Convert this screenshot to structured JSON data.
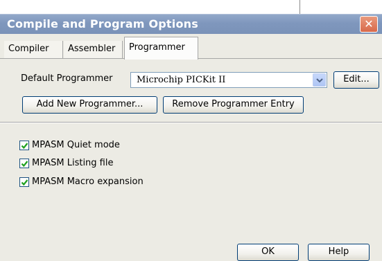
{
  "window": {
    "title": "Compile and Program Options",
    "close_label": "✕"
  },
  "tabs": [
    {
      "label": "Compiler",
      "active": false
    },
    {
      "label": "Assembler",
      "active": false
    },
    {
      "label": "Programmer",
      "active": true
    }
  ],
  "programmer": {
    "default_label": "Default Programmer",
    "selected_value": "Microchip PICKit II",
    "edit_label": "Edit...",
    "add_label": "Add New Programmer...",
    "remove_label": "Remove Programmer Entry"
  },
  "options": [
    {
      "label": "MPASM Quiet mode",
      "checked": true
    },
    {
      "label": "MPASM Listing file",
      "checked": true
    },
    {
      "label": "MPASM Macro expansion",
      "checked": true
    }
  ],
  "footer": {
    "ok_label": "OK",
    "help_label": "Help"
  },
  "colors": {
    "titlebar": "#7f97bd",
    "dialog_bg": "#ecebe4",
    "checkmark": "#21a121",
    "close_button": "#d8694a"
  }
}
